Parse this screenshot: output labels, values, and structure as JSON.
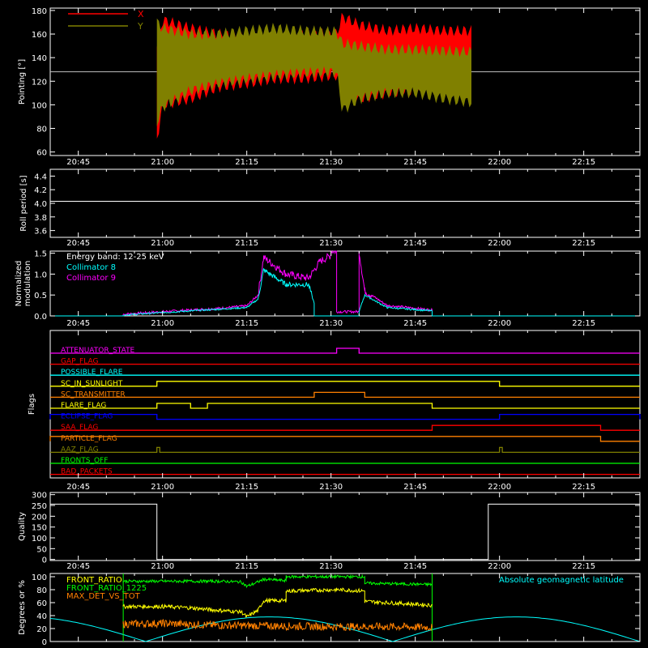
{
  "figure": {
    "background": "#000000",
    "axis_color": "#ffffff"
  },
  "time_ticks": [
    "20:45",
    "21:00",
    "21:15",
    "21:30",
    "21:45",
    "22:00",
    "22:15"
  ],
  "chart_data": [
    {
      "id": "pointing",
      "type": "area",
      "ylabel": "Pointing [°]",
      "ylim": [
        57,
        182
      ],
      "yticks": [
        "60",
        "80",
        "100",
        "120",
        "140",
        "160",
        "180"
      ],
      "xlim": [
        "20:40",
        "22:25"
      ],
      "reference_line": 128,
      "series": [
        {
          "name": "X",
          "color": "#ff0000",
          "envelope": [
            [
              "20:58:30",
              null,
              null
            ],
            [
              "20:59",
              70,
              150
            ],
            [
              "21:00",
              100,
              172
            ],
            [
              "21:05",
              105,
              165
            ],
            [
              "21:10",
              115,
              160
            ],
            [
              "21:15",
              118,
              158
            ],
            [
              "21:20",
              122,
              158
            ],
            [
              "21:25",
              122,
              160
            ],
            [
              "21:31",
              125,
              160
            ],
            [
              "21:32",
              110,
              175
            ],
            [
              "21:35",
              105,
              168
            ],
            [
              "21:40",
              110,
              163
            ],
            [
              "21:45",
              113,
              165
            ],
            [
              "21:50",
              115,
              163
            ],
            [
              "21:55",
              112,
              163
            ]
          ]
        },
        {
          "name": "Y",
          "color": "#808000",
          "envelope": [
            [
              "20:58:30",
              null,
              null
            ],
            [
              "20:59",
              85,
              170
            ],
            [
              "21:00",
              98,
              165
            ],
            [
              "21:05",
              112,
              160
            ],
            [
              "21:10",
              118,
              160
            ],
            [
              "21:15",
              122,
              163
            ],
            [
              "21:20",
              125,
              165
            ],
            [
              "21:25",
              127,
              163
            ],
            [
              "21:31",
              128,
              162
            ],
            [
              "21:32",
              95,
              152
            ],
            [
              "21:35",
              105,
              150
            ],
            [
              "21:40",
              110,
              147
            ],
            [
              "21:45",
              110,
              147
            ],
            [
              "21:50",
              105,
              146
            ],
            [
              "21:55",
              102,
              145
            ]
          ]
        }
      ]
    },
    {
      "id": "roll_period",
      "type": "line",
      "ylabel": "Roll period [s]",
      "ylim": [
        3.5,
        4.5
      ],
      "yticks": [
        "3.6",
        "3.8",
        "4.0",
        "4.2",
        "4.4"
      ],
      "series": [
        {
          "name": "",
          "color": "#ffffff",
          "x": [
            "20:40",
            "22:25"
          ],
          "y": [
            4.03,
            4.03
          ]
        }
      ]
    },
    {
      "id": "modulation",
      "type": "line",
      "ylabel": "Normalized modulation",
      "ylim": [
        0,
        1.55
      ],
      "yticks": [
        "0.0",
        "0.5",
        "1.0",
        "1.5"
      ],
      "annotation": "Energy band: 12-25 keV",
      "series": [
        {
          "name": "Collimator 8",
          "color": "#00ffff",
          "x": [
            "20:40",
            "20:53",
            "20:53",
            "21:00",
            "21:05",
            "21:10",
            "21:15",
            "21:17",
            "21:18",
            "21:22",
            "21:26",
            "21:27",
            "21:27",
            "21:35",
            "21:35",
            "21:36",
            "21:40",
            "21:48",
            "21:48",
            "22:25"
          ],
          "y": [
            0,
            0,
            0.02,
            0.08,
            0.12,
            0.16,
            0.2,
            0.4,
            1.1,
            0.75,
            0.75,
            0.3,
            0,
            0,
            0.1,
            0.5,
            0.2,
            0.12,
            0,
            0
          ]
        },
        {
          "name": "Collimator 9",
          "color": "#ff00ff",
          "x": [
            "20:40",
            "20:53",
            "20:53",
            "21:00",
            "21:05",
            "21:10",
            "21:15",
            "21:17",
            "21:18",
            "21:22",
            "21:26",
            "21:28",
            "21:30",
            "21:30",
            "21:31",
            "21:31",
            "21:35",
            "21:35",
            "21:36",
            "21:40",
            "21:48",
            "21:48",
            "22:25"
          ],
          "y": [
            0,
            0,
            0.04,
            0.1,
            0.14,
            0.18,
            0.24,
            0.5,
            1.4,
            1.0,
            0.9,
            1.3,
            1.45,
            1.55,
            1.55,
            0.1,
            0.1,
            1.55,
            0.6,
            0.25,
            0.14,
            0,
            0
          ]
        }
      ]
    },
    {
      "id": "flags",
      "type": "line",
      "ylabel": "Flags",
      "series": [
        {
          "name": "ATTENUATOR_STATE",
          "color": "#ff00ff",
          "on": [
            [
              "21:31",
              "21:35"
            ]
          ]
        },
        {
          "name": "GAP_FLAG",
          "color": "#ff0000",
          "on": []
        },
        {
          "name": "POSSIBLE_FLARE",
          "color": "#00ffff",
          "on": []
        },
        {
          "name": "SC_IN_SUNLIGHT",
          "color": "#ffff00",
          "on": [
            [
              "20:59",
              "22:00"
            ]
          ]
        },
        {
          "name": "SC_TRANSMITTER",
          "color": "#ff8000",
          "on": [
            [
              "21:27",
              "21:36"
            ]
          ]
        },
        {
          "name": "FLARE_FLAG",
          "color": "#ffff00",
          "on": [
            [
              "20:59",
              "21:05"
            ],
            [
              "21:08",
              "21:48"
            ]
          ]
        },
        {
          "name": "ECLIPSE_FLAG",
          "color": "#0000ff",
          "on": [
            [
              "20:40",
              "20:59"
            ],
            [
              "22:00",
              "22:25"
            ]
          ]
        },
        {
          "name": "SAA_FLAG",
          "color": "#ff0000",
          "on": [
            [
              "21:48",
              "22:18"
            ]
          ]
        },
        {
          "name": "PARTICLE_FLAG",
          "color": "#ff8000",
          "on": [
            [
              "20:40",
              "22:18"
            ]
          ]
        },
        {
          "name": "AAZ_FLAG",
          "color": "#808000",
          "on": [
            [
              "20:59",
              "20:59:30"
            ],
            [
              "22:00",
              "22:00:30"
            ]
          ]
        },
        {
          "name": "FRONTS_OFF",
          "color": "#00ff00",
          "on": []
        },
        {
          "name": "BAD_PACKETS",
          "color": "#ff0000",
          "on": []
        }
      ]
    },
    {
      "id": "quality",
      "type": "line",
      "ylabel": "Quality",
      "ylim": [
        -5,
        310
      ],
      "yticks": [
        "0",
        "50",
        "100",
        "150",
        "200",
        "250",
        "300"
      ],
      "series": [
        {
          "name": "",
          "color": "#ffffff",
          "x": [
            "20:40",
            "20:59",
            "20:59",
            "21:58",
            "21:58",
            "22:25"
          ],
          "y": [
            256,
            256,
            0,
            0,
            256,
            256
          ]
        }
      ]
    },
    {
      "id": "ratios",
      "type": "line",
      "ylabel": "Degrees or %",
      "ylim": [
        0,
        105
      ],
      "yticks": [
        "0",
        "20",
        "40",
        "60",
        "80",
        "100"
      ],
      "right_legend": "Absolute geomagnetic latitude",
      "series": [
        {
          "name": "FRONT_RATIO",
          "color": "#ffff00",
          "x": [
            "20:53",
            "21:00",
            "21:05",
            "21:10",
            "21:14",
            "21:15",
            "21:17",
            "21:18",
            "21:22",
            "21:22",
            "21:31",
            "21:36",
            "21:36",
            "21:48"
          ],
          "y": [
            54,
            54,
            52,
            48,
            46,
            38,
            48,
            63,
            63,
            78,
            80,
            78,
            62,
            56
          ]
        },
        {
          "name": "FRONT_RATIO_1225",
          "color": "#00ff00",
          "x": [
            "20:53",
            "21:00",
            "21:10",
            "21:14",
            "21:15",
            "21:17",
            "21:18",
            "21:22",
            "21:22",
            "21:31",
            "21:36",
            "21:36",
            "21:48"
          ],
          "y": [
            93,
            93,
            93,
            92,
            85,
            92,
            96,
            94,
            100,
            100,
            100,
            90,
            88
          ]
        },
        {
          "name": "MAX_DET_VS_TOT",
          "color": "#ff8000",
          "x": [
            "20:53",
            "21:00",
            "21:10",
            "21:20",
            "21:30",
            "21:40",
            "21:48"
          ],
          "y": [
            27,
            28,
            25,
            24,
            23,
            23,
            22
          ]
        },
        {
          "name": "",
          "color": "#00ffff",
          "shape": "geomag",
          "x": [
            "20:40",
            "20:50",
            "20:57",
            "21:03",
            "21:22",
            "21:41",
            "21:48",
            "21:56",
            "22:14",
            "22:25"
          ],
          "y": [
            38,
            18,
            4,
            4,
            38,
            4,
            4,
            4,
            38,
            25
          ]
        }
      ]
    }
  ]
}
